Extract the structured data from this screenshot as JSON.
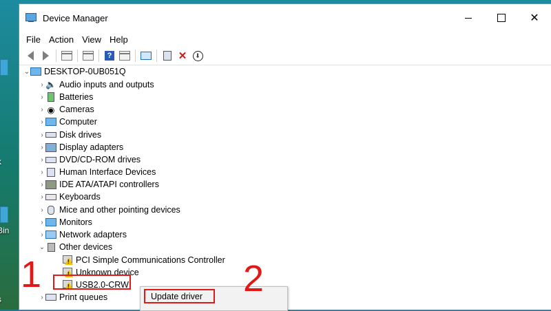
{
  "window": {
    "title": "Device Manager",
    "buttons": {
      "minimize": "—",
      "maximize": "☐",
      "close": "✕"
    }
  },
  "menu": [
    "File",
    "Action",
    "View",
    "Help"
  ],
  "toolbar": [
    "back-icon",
    "forward-icon",
    "properties-icon",
    "update-icon",
    "help-icon",
    "view-icon",
    "scan-icon",
    "enable-icon",
    "uninstall-icon",
    "download-icon"
  ],
  "tree": {
    "root": "DESKTOP-0UB051Q",
    "categories": [
      "Audio inputs and outputs",
      "Batteries",
      "Cameras",
      "Computer",
      "Disk drives",
      "Display adapters",
      "DVD/CD-ROM drives",
      "Human Interface Devices",
      "IDE ATA/ATAPI controllers",
      "Keyboards",
      "Mice and other pointing devices",
      "Monitors",
      "Network adapters",
      "Other devices"
    ],
    "other_devices": [
      "PCI Simple Communications Controller",
      "Unknown device",
      "USB2.0-CRW"
    ],
    "after": "Print queues"
  },
  "context_menu": {
    "item": "Update driver"
  },
  "annotations": {
    "step1": "1",
    "step2": "2"
  },
  "desktop_labels": [
    "k",
    "Bin",
    "s"
  ],
  "colors": {
    "accent_red": "#e01818",
    "warning": "#f2c200"
  }
}
